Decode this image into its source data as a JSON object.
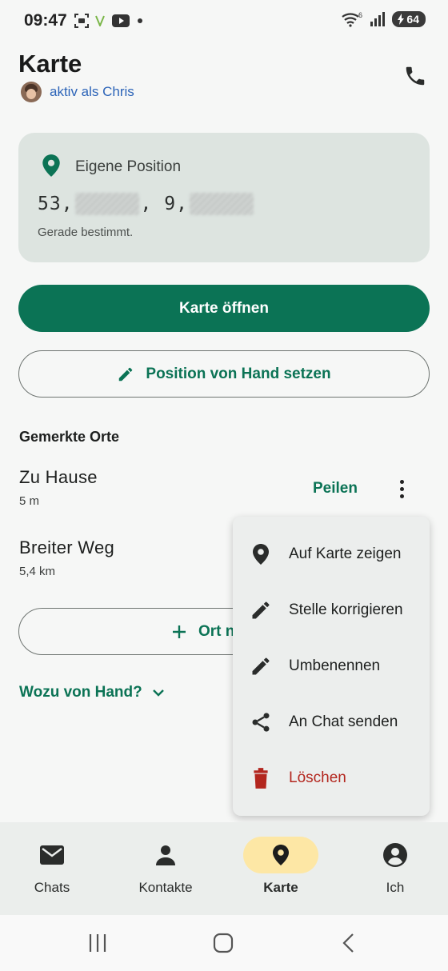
{
  "status_bar": {
    "time": "09:47",
    "battery": "64",
    "wifi_label": "6"
  },
  "header": {
    "title": "Karte",
    "active_as": "aktiv als Chris"
  },
  "position_card": {
    "title": "Eigene Position",
    "coord_lat_prefix": "53,",
    "coord_lon_prefix": ", 9,",
    "subtitle": "Gerade bestimmt."
  },
  "actions": {
    "open_map": "Karte öffnen",
    "set_manual": "Position von Hand setzen",
    "add_place": "Ort n",
    "why_manual": "Wozu von Hand?"
  },
  "saved_places": {
    "title": "Gemerkte Orte",
    "items": [
      {
        "name": "Zu Hause",
        "distance": "5 m",
        "action": "Peilen"
      },
      {
        "name": "Breiter Weg",
        "distance": "5,4 km"
      }
    ]
  },
  "context_menu": {
    "items": [
      {
        "label": "Auf Karte zeigen",
        "icon": "map-pin-icon"
      },
      {
        "label": "Stelle korrigieren",
        "icon": "pencil-icon"
      },
      {
        "label": "Umbenennen",
        "icon": "pencil-icon"
      },
      {
        "label": "An Chat senden",
        "icon": "share-icon"
      },
      {
        "label": "Löschen",
        "icon": "trash-icon",
        "color": "#b3261e"
      }
    ]
  },
  "bottom_nav": {
    "items": [
      {
        "label": "Chats",
        "icon": "mail-icon"
      },
      {
        "label": "Kontakte",
        "icon": "person-icon"
      },
      {
        "label": "Karte",
        "icon": "map-pin-icon",
        "active": true
      },
      {
        "label": "Ich",
        "icon": "account-circle-icon"
      }
    ]
  },
  "colors": {
    "accent": "#0b7355",
    "link": "#2c64b8",
    "danger": "#b3261e",
    "active_nav": "#fde7a5"
  }
}
